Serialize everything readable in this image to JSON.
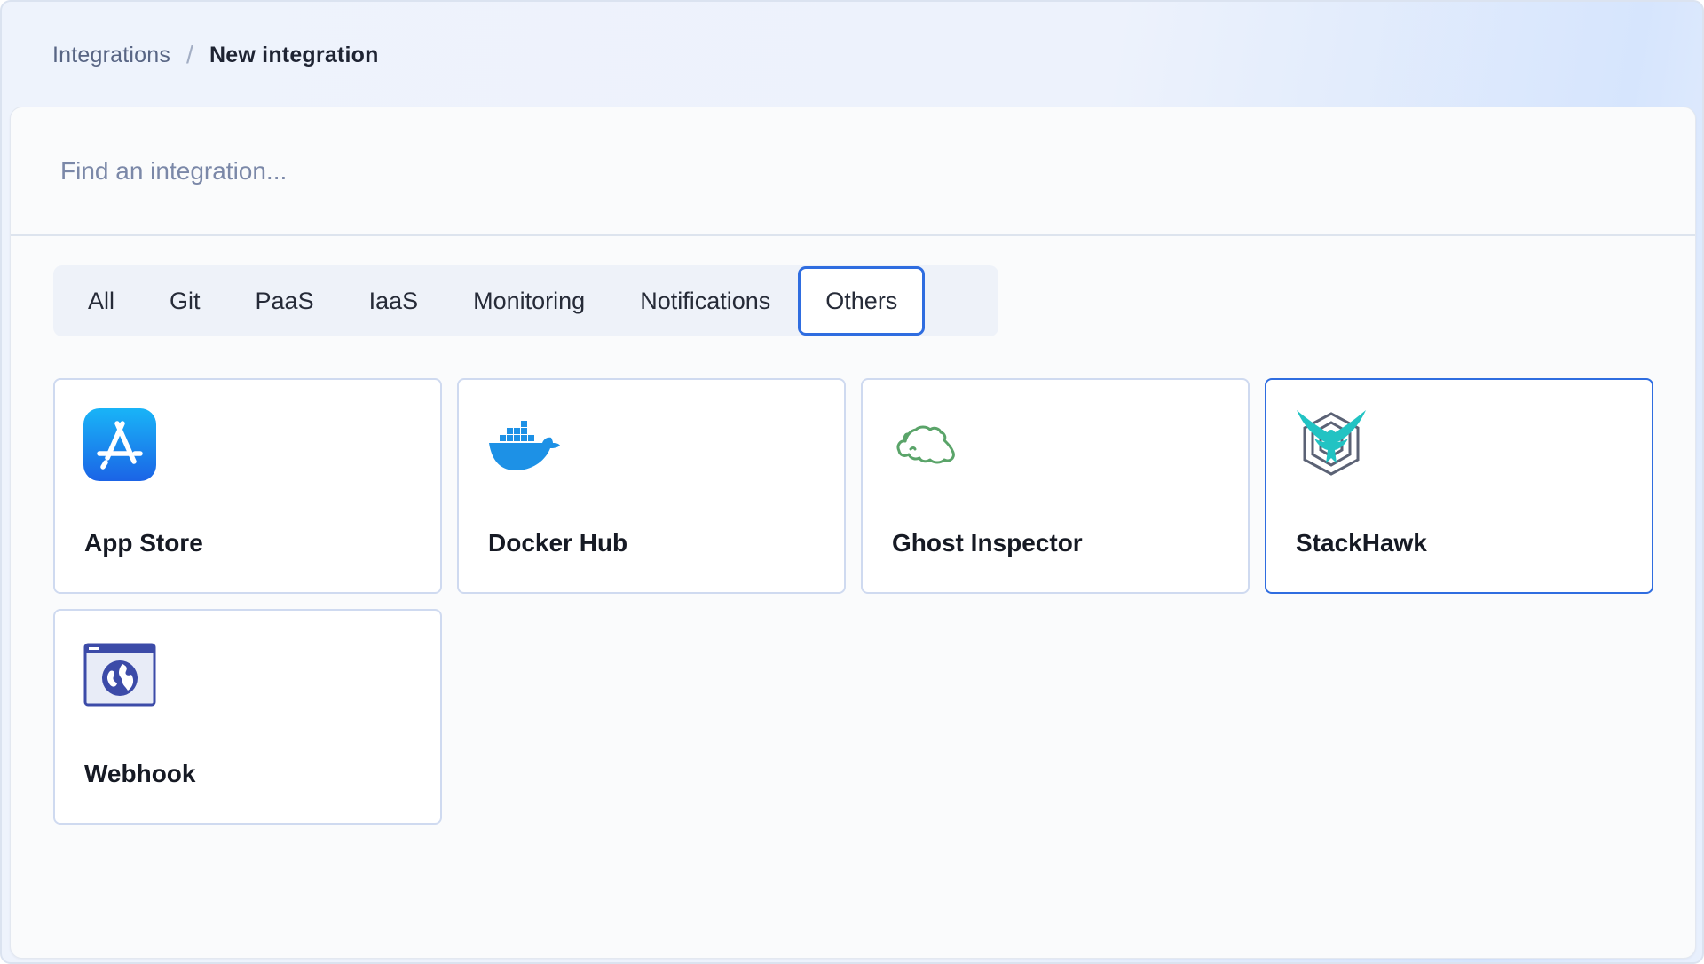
{
  "breadcrumb": {
    "parent": "Integrations",
    "separator": "/",
    "current": "New integration"
  },
  "search": {
    "placeholder": "Find an integration...",
    "value": ""
  },
  "tabs": [
    {
      "label": "All",
      "active": false
    },
    {
      "label": "Git",
      "active": false
    },
    {
      "label": "PaaS",
      "active": false
    },
    {
      "label": "IaaS",
      "active": false
    },
    {
      "label": "Monitoring",
      "active": false
    },
    {
      "label": "Notifications",
      "active": false
    },
    {
      "label": "Others",
      "active": true
    }
  ],
  "integrations": [
    {
      "name": "App Store",
      "icon": "app-store-icon",
      "selected": false
    },
    {
      "name": "Docker Hub",
      "icon": "docker-icon",
      "selected": false
    },
    {
      "name": "Ghost Inspector",
      "icon": "ghost-icon",
      "selected": false
    },
    {
      "name": "StackHawk",
      "icon": "stackhawk-icon",
      "selected": true
    },
    {
      "name": "Webhook",
      "icon": "webhook-icon",
      "selected": false
    }
  ],
  "colors": {
    "accent": "#2f6de0",
    "app_store": "#1a8cf0",
    "docker": "#1d91e6",
    "ghost_inspector": "#5aa469",
    "stackhawk_teal": "#22c3c3",
    "stackhawk_gray": "#5b6275",
    "webhook": "#3c4ba8"
  }
}
